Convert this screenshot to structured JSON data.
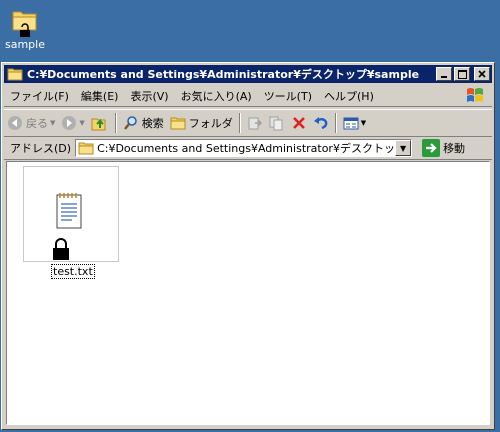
{
  "desktop": {
    "icons": [
      {
        "label": "sample",
        "icon": "locked-folder-icon"
      }
    ],
    "background_color": "#3a6ea5"
  },
  "window": {
    "title": "C:¥Documents and Settings¥Administrator¥デスクトップ¥sample",
    "title_icon": "folder-icon",
    "caption_buttons": [
      "minimize",
      "maximize",
      "close"
    ],
    "titlebar_color": "#0a246a"
  },
  "menubar": {
    "items": [
      {
        "label": "ファイル(F)"
      },
      {
        "label": "編集(E)"
      },
      {
        "label": "表示(V)"
      },
      {
        "label": "お気に入り(A)"
      },
      {
        "label": "ツール(T)"
      },
      {
        "label": "ヘルプ(H)"
      }
    ]
  },
  "toolbar": {
    "back_label": "戻る",
    "search_label": "検索",
    "folders_label": "フォルダ"
  },
  "addressbar": {
    "label": "アドレス(D)",
    "value": "C:¥Documents and Settings¥Administrator¥デスクトップ¥sample",
    "go_label": "移動"
  },
  "content": {
    "files": [
      {
        "name": "test.txt",
        "icon": "text-document-icon",
        "locked": true
      }
    ]
  }
}
